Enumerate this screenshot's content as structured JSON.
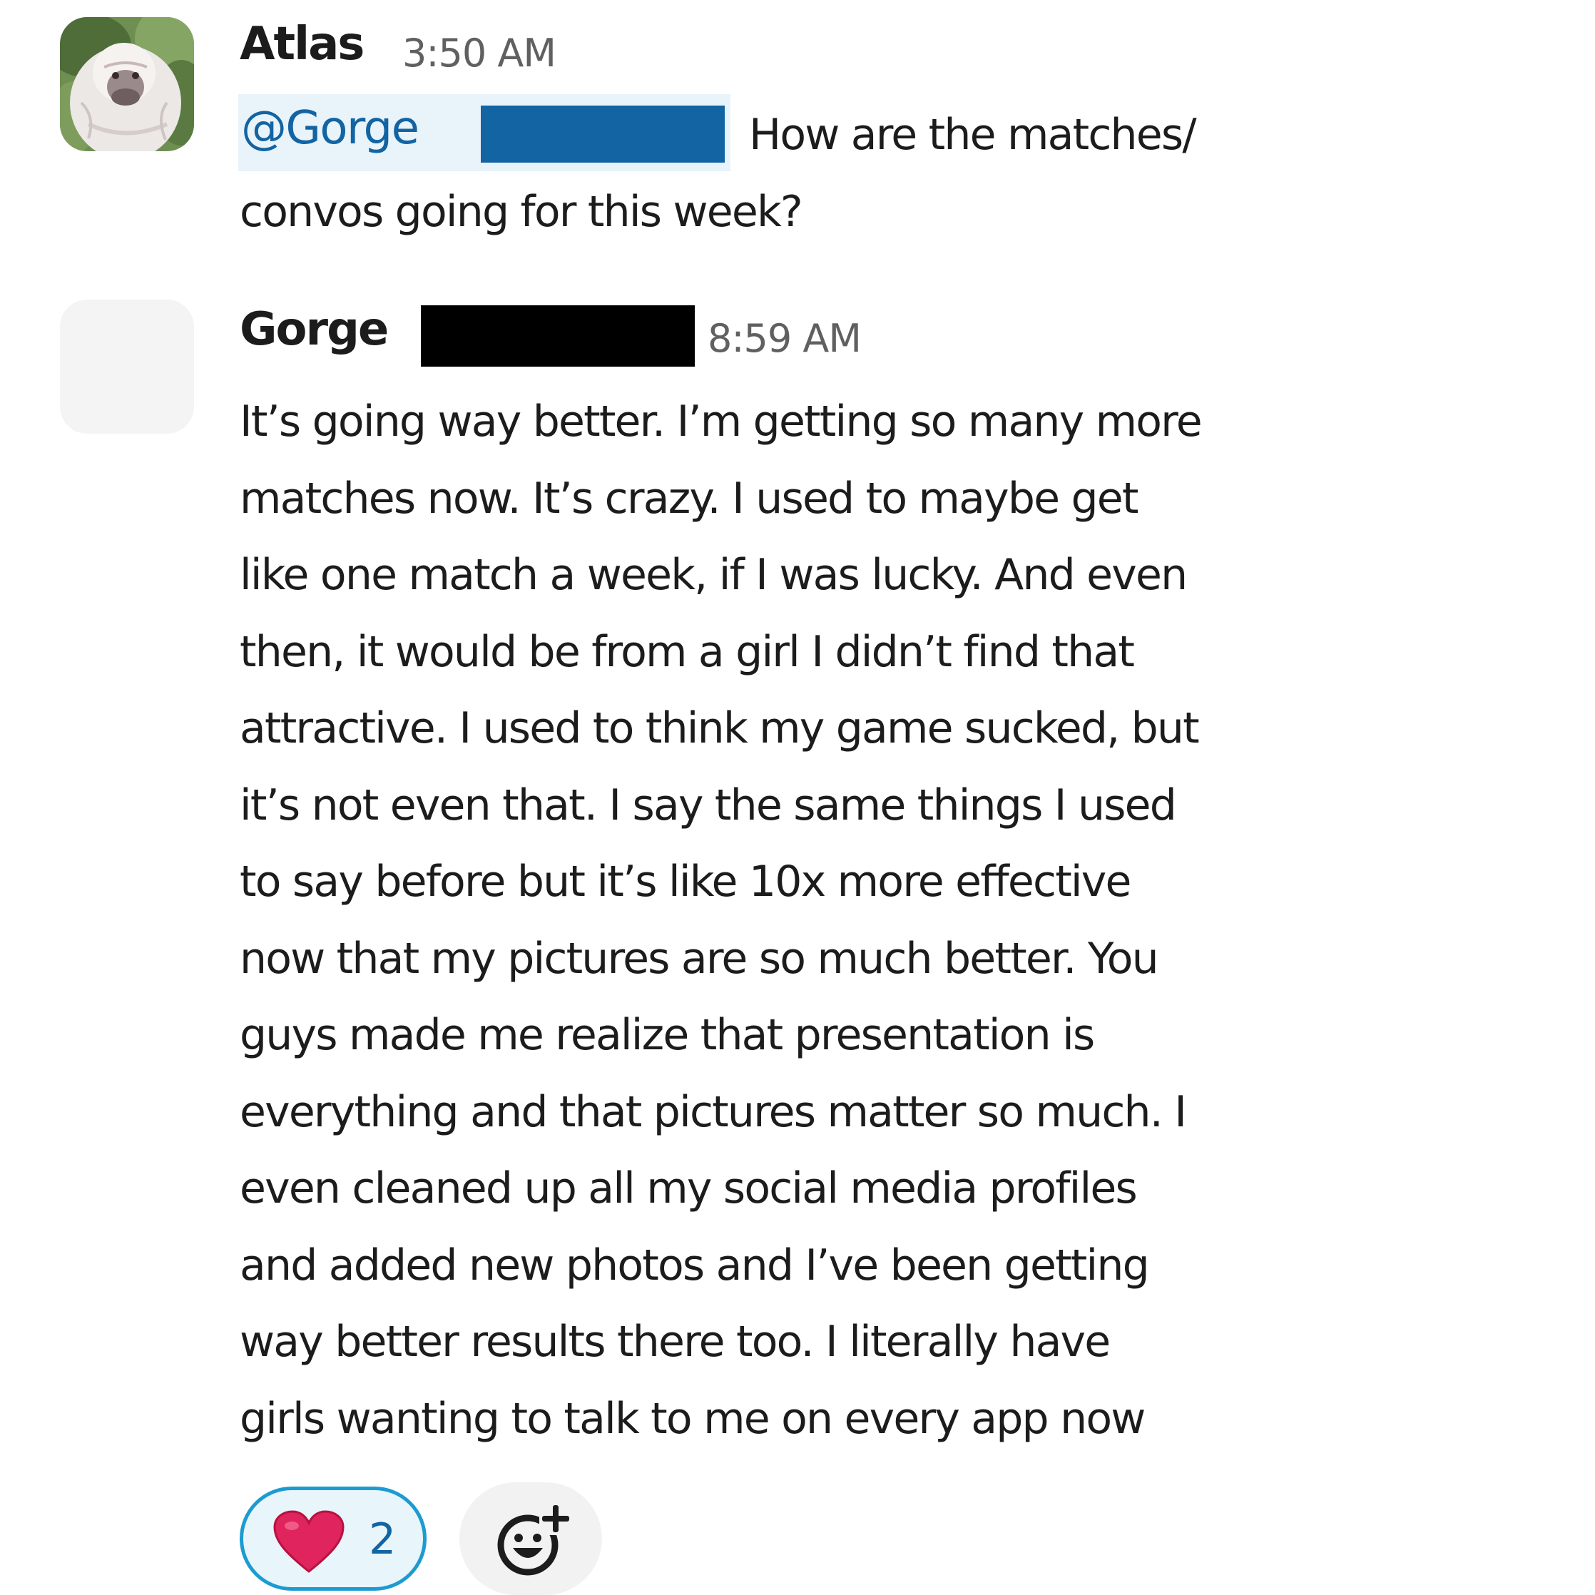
{
  "messages": [
    {
      "author": "Atlas",
      "time": "3:50 AM",
      "mention": "@Gorge",
      "text_lines": [
        "How are the matches/",
        "convos going for this week?"
      ]
    },
    {
      "author": "Gorge",
      "time": "8:59 AM",
      "text_lines": [
        "It’s going way better. I’m getting so many more",
        "matches now. It’s crazy. I used to maybe get",
        "like one match a week, if I was lucky. And even",
        "then, it would be from a girl I didn’t find that",
        "attractive. I used to think my game sucked, but",
        "it’s not even that. I say the same things I used",
        "to say before but it’s like 10x more effective",
        "now that my pictures are so much better. You",
        "guys made me realize that presentation is",
        "everything and that pictures matter so much. I",
        "even cleaned up all my social media profiles",
        "and added new photos and I’ve been getting",
        "way better results there too. I literally have",
        "girls wanting to talk to me on every app now"
      ],
      "reactions": [
        {
          "emoji": "heart-emoji",
          "count": "2"
        }
      ],
      "add_reaction_icon": "add-reaction-icon"
    }
  ],
  "colors": {
    "mention_text": "#1264a3",
    "mention_bg": "#e8f3fa",
    "mention_redaction": "#1264a3",
    "name_redaction": "#000000",
    "reaction_border": "#1d9bd1",
    "reaction_bg": "#e8f5fa",
    "heart": "#e0245e"
  }
}
